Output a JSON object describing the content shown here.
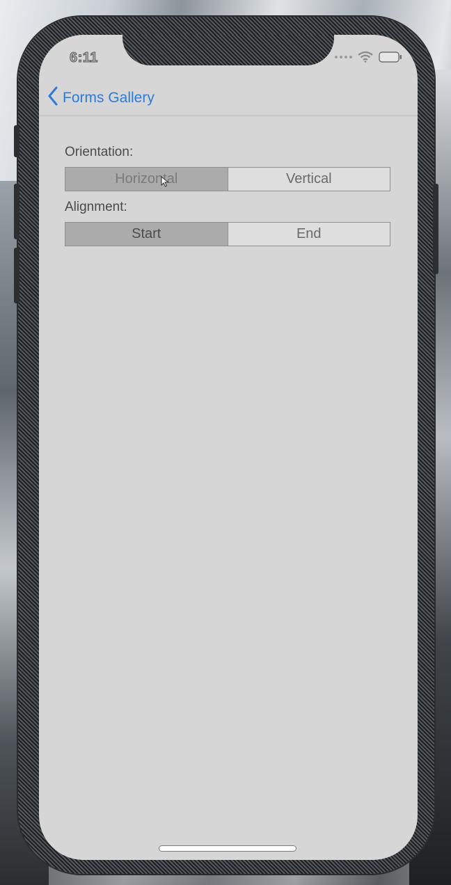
{
  "status_bar": {
    "time": "6:11"
  },
  "nav": {
    "back_label": "Forms Gallery"
  },
  "orientation": {
    "label": "Orientation:",
    "options": [
      "Horizontal",
      "Vertical"
    ],
    "selected": "Horizontal"
  },
  "alignment": {
    "label": "Alignment:",
    "options": [
      "Start",
      "End"
    ],
    "selected": "Start"
  },
  "colors": {
    "accent": "#2f7ad8",
    "screen_background": "#d6d6d6",
    "selected_segment": "#ababab"
  },
  "icons": {
    "back": "chevron-left-icon",
    "wifi": "wifi-icon",
    "battery": "battery-icon",
    "cursor": "mouse-pointer-icon"
  }
}
